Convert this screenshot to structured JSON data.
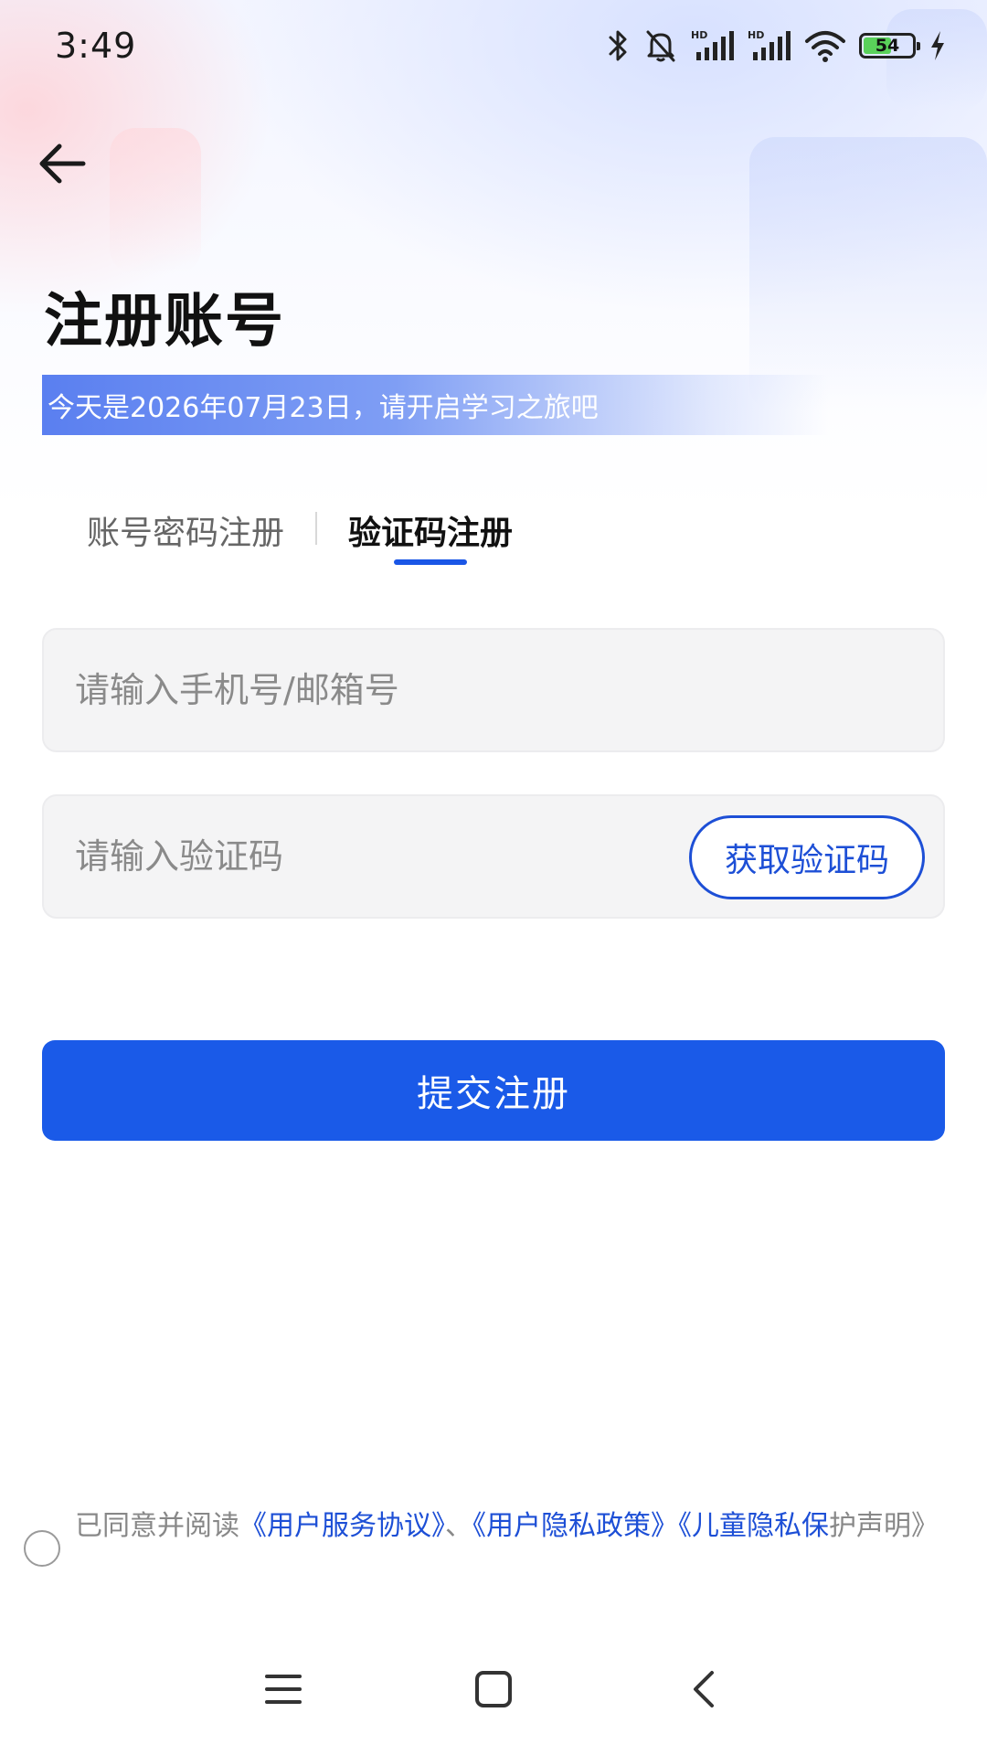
{
  "status_bar": {
    "time": "3:49",
    "battery_level": "54",
    "icons": [
      "bluetooth-icon",
      "mute-icon",
      "signal-hd-icon",
      "signal-hd-icon",
      "wifi-icon",
      "battery-icon",
      "charging-icon"
    ]
  },
  "header": {
    "back_icon": "arrow-left-icon",
    "title": "注册账号",
    "date_banner": "今天是2026年07月23日，请开启学习之旅吧"
  },
  "tabs": [
    {
      "label": "账号密码注册",
      "active": false
    },
    {
      "label": "验证码注册",
      "active": true
    }
  ],
  "form": {
    "account_placeholder": "请输入手机号/邮箱号",
    "account_value": "",
    "code_placeholder": "请输入验证码",
    "code_value": "",
    "get_code_label": "获取验证码",
    "submit_label": "提交注册"
  },
  "agreement": {
    "checked": false,
    "prefix": "已同意并阅读",
    "user_agreement": "《用户服务协议》",
    "separator": "、",
    "privacy_policy": "《用户隐私政策》",
    "children_privacy_link": "《儿童隐私保",
    "children_privacy_rest": "护声明》"
  },
  "nav_bar": {
    "icons": [
      "menu-icon",
      "home-icon",
      "back-icon"
    ]
  },
  "colors": {
    "accent": "#1a5ae8",
    "link": "#1d4fd6",
    "banner_start": "#5a7ff0"
  }
}
